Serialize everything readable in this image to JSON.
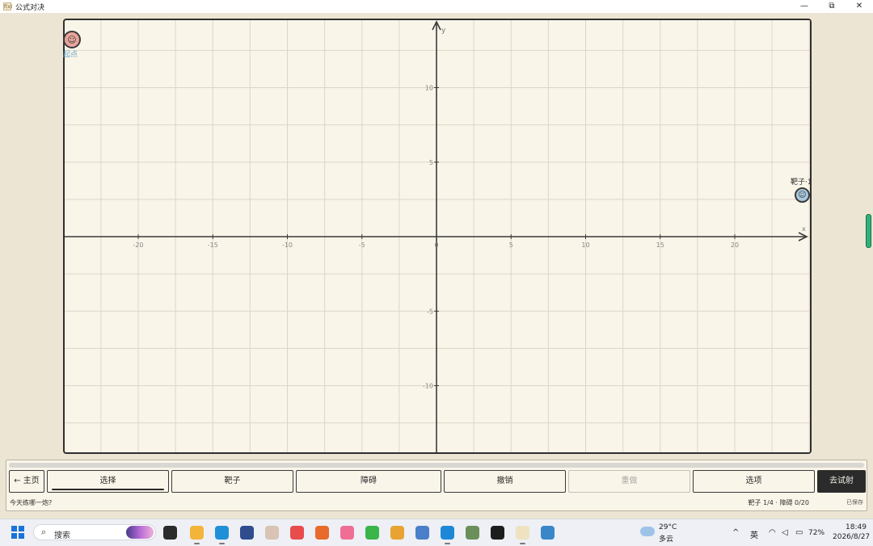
{
  "window": {
    "app_icon": "fx-app-icon",
    "title": "公式对决",
    "minimize": "—",
    "restore": "⧉",
    "close": "✕"
  },
  "plot": {
    "x_axis_label": "x",
    "y_axis_label": "y",
    "xlim": [
      -25,
      25
    ],
    "ylim": [
      -14.5,
      14.5
    ],
    "grid": true,
    "x_ticks": [
      -20,
      -15,
      -10,
      -5,
      0,
      5,
      10,
      15,
      20
    ],
    "y_ticks": [
      -10,
      -5,
      5,
      10
    ],
    "x_tick_labels": [
      "-20",
      "-15",
      "-10",
      "-5",
      "0",
      "5",
      "10",
      "15",
      "20"
    ],
    "y_tick_labels": [
      "-10",
      "-5",
      "5",
      "10"
    ]
  },
  "markers": {
    "start": {
      "label": "起点",
      "face": "☺",
      "color": "#e9a49b",
      "x": -24.4,
      "y": 14.2
    },
    "target": {
      "label": "靶子·1",
      "face": "☺",
      "color": "#aac9df",
      "x": 24.6,
      "y": 3.6
    }
  },
  "toolbar": {
    "home": "← 主页",
    "select": "选择",
    "target": "靶子",
    "obstacle": "障碍",
    "undo": "撤销",
    "redo": "重做",
    "options": "选项",
    "go": "去试射"
  },
  "footer": {
    "hint": "今天练哪一炮?",
    "status": "靶子 1/4 · 障碍 0/20",
    "saved": "已保存"
  },
  "taskbar": {
    "search_placeholder": "搜索",
    "weather_temp": "29°C",
    "weather_desc": "多云",
    "tray_chevron": "^",
    "ime": "英",
    "wifi_icon": "wifi-icon",
    "volume_icon": "speaker-icon",
    "battery": "72%",
    "time": "18:49",
    "date": "2026/8/27",
    "apps": [
      {
        "name": "task-view-icon",
        "color": "#2b2b2b"
      },
      {
        "name": "file-explorer-icon",
        "color": "#f2b53a"
      },
      {
        "name": "edge-icon",
        "color": "#1f8fd8"
      },
      {
        "name": "devtools-icon",
        "color": "#2f4c8f"
      },
      {
        "name": "avatar-app-icon",
        "color": "#d8c3b5"
      },
      {
        "name": "f-app-icon",
        "color": "#e84c4c"
      },
      {
        "name": "orange-app-icon",
        "color": "#e86a2c"
      },
      {
        "name": "bilibili-icon",
        "color": "#f06e96"
      },
      {
        "name": "green-e-icon",
        "color": "#39b54a"
      },
      {
        "name": "notes-app-icon",
        "color": "#e8a332"
      },
      {
        "name": "gear-bot-icon",
        "color": "#4a7fc9"
      },
      {
        "name": "vscode-icon",
        "color": "#1e88d8"
      },
      {
        "name": "game-app-icon",
        "color": "#6b8f5a"
      },
      {
        "name": "top-app-icon",
        "color": "#1d1d1d"
      },
      {
        "name": "formula-duel-icon",
        "color": "#efe2c0"
      },
      {
        "name": "notepad-icon",
        "color": "#3a86c8"
      }
    ]
  }
}
